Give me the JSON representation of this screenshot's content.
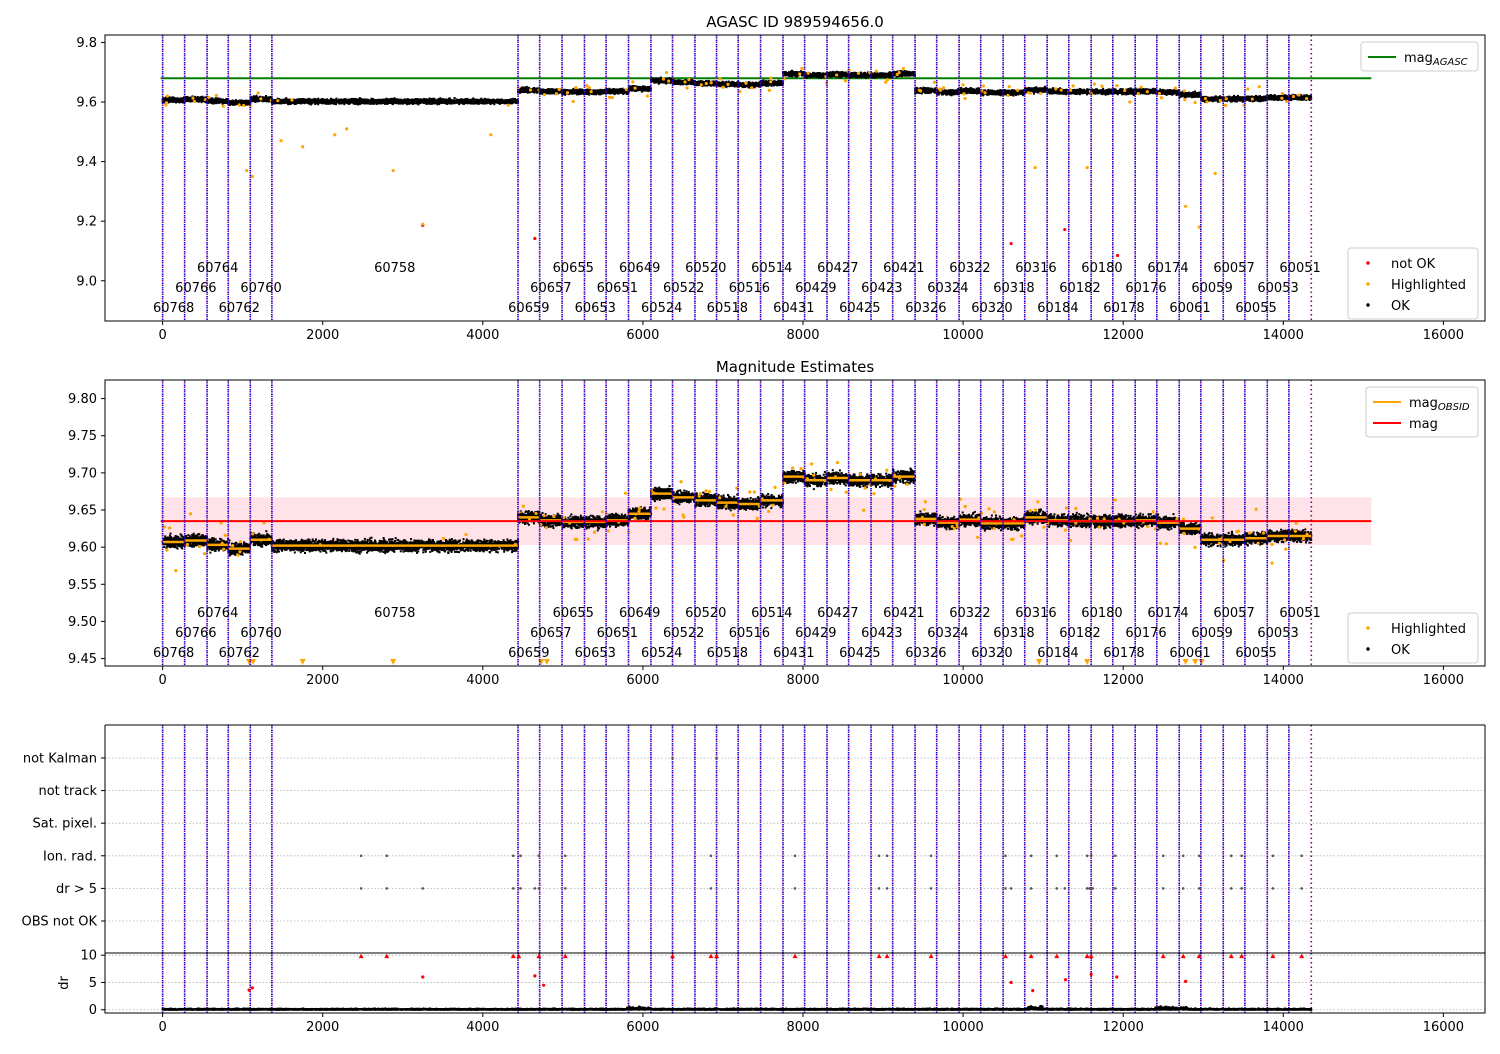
{
  "chart_data": [
    {
      "type": "scatter",
      "title": "AGASC ID 989594656.0",
      "xlim": [
        -720,
        16520
      ],
      "ylim": [
        8.865,
        9.825
      ],
      "xticks": [
        0,
        2000,
        4000,
        6000,
        8000,
        10000,
        12000,
        14000,
        16000
      ],
      "yticks": [
        9.0,
        9.2,
        9.4,
        9.6,
        9.8
      ],
      "ytick_labels": [
        "9.0",
        "9.2",
        "9.4",
        "9.6",
        "9.8"
      ],
      "mag_agasc": 9.68,
      "mag_agasc_color": "#008000",
      "legend_top": [
        {
          "label": "mag",
          "sub": "AGASC",
          "color": "#008000",
          "kind": "line"
        }
      ],
      "legend_bottom": [
        {
          "label": "not OK",
          "color": "#ff0000",
          "kind": "dot"
        },
        {
          "label": "Highlighted",
          "color": "#ffa500",
          "kind": "dot"
        },
        {
          "label": "OK",
          "color": "#000000",
          "kind": "dot"
        }
      ],
      "legend_top_placement": "upper right",
      "legend_bottom_placement": "lower right",
      "grid": false
    },
    {
      "type": "scatter",
      "title": "Magnitude Estimates",
      "xlim": [
        -720,
        16520
      ],
      "ylim": [
        9.44,
        9.825
      ],
      "xticks": [
        0,
        2000,
        4000,
        6000,
        8000,
        10000,
        12000,
        14000,
        16000
      ],
      "yticks": [
        9.45,
        9.5,
        9.55,
        9.6,
        9.65,
        9.7,
        9.75,
        9.8
      ],
      "ytick_labels": [
        "9.45",
        "9.50",
        "9.55",
        "9.60",
        "9.65",
        "9.70",
        "9.75",
        "9.80"
      ],
      "mag": 9.635,
      "mag_band": [
        9.603,
        9.667
      ],
      "mag_color": "#ff0000",
      "mag_obsid_color": "#ffa500",
      "legend_top": [
        {
          "label": "mag",
          "sub": "OBSID",
          "color": "#ffa500",
          "kind": "line"
        },
        {
          "label": "mag",
          "sub": "",
          "color": "#ff0000",
          "kind": "line"
        }
      ],
      "legend_bottom": [
        {
          "label": "Highlighted",
          "color": "#ffa500",
          "kind": "dot"
        },
        {
          "label": "OK",
          "color": "#000000",
          "kind": "dot"
        }
      ],
      "legend_top_placement": "upper right",
      "legend_bottom_placement": "lower right",
      "grid": false
    },
    {
      "type": "scatter",
      "title": "",
      "xlim": [
        -720,
        16520
      ],
      "flag_labels": [
        "not Kalman",
        "not track",
        "Sat. pixel.",
        "Ion. rad.",
        "dr > 5",
        "OBS not OK"
      ],
      "dr_ylabel": "dr",
      "dr_ylim": [
        -0.6,
        10.4
      ],
      "dr_yticks": [
        0,
        5,
        10
      ],
      "dr_ytick_labels": [
        "0",
        "5",
        "10"
      ],
      "xticks": [
        0,
        2000,
        4000,
        6000,
        8000,
        10000,
        12000,
        14000,
        16000
      ],
      "grid_horizontal": true,
      "not_kalman": [
        6370,
        6920
      ],
      "ion_rad": [
        2480,
        2800,
        4380,
        4470,
        4700,
        5030,
        6850,
        7900,
        8950,
        9050,
        9600,
        10530,
        10850,
        11170,
        11550,
        11600,
        11900,
        12500,
        12750,
        12950,
        13350,
        13480,
        13870,
        14230
      ],
      "dr_gt_5": [
        2480,
        2800,
        3250,
        4380,
        4470,
        4650,
        4700,
        5030,
        6850,
        7900,
        8950,
        9050,
        9600,
        10530,
        10600,
        10850,
        11170,
        11270,
        11550,
        11580,
        11620,
        11900,
        12500,
        12750,
        12950,
        13350,
        13480,
        13870,
        14230
      ],
      "dr_capped": [
        2480,
        2800,
        4380,
        4450,
        4700,
        5030,
        6370,
        6850,
        6920,
        7900,
        8950,
        9050,
        9600,
        10530,
        10850,
        11170,
        11550,
        11600,
        12500,
        12750,
        12950,
        13350,
        13480,
        13870,
        14230
      ],
      "dr_points": [
        {
          "x": 1080,
          "y": 3.6
        },
        {
          "x": 1120,
          "y": 4.0
        },
        {
          "x": 3250,
          "y": 6.0
        },
        {
          "x": 4650,
          "y": 6.2
        },
        {
          "x": 4760,
          "y": 4.5
        },
        {
          "x": 10600,
          "y": 5.0
        },
        {
          "x": 10870,
          "y": 3.5
        },
        {
          "x": 11280,
          "y": 5.5
        },
        {
          "x": 11600,
          "y": 6.5
        },
        {
          "x": 11920,
          "y": 6.0
        },
        {
          "x": 12780,
          "y": 5.2
        }
      ]
    }
  ],
  "obsids": [
    {
      "id": "60768",
      "x": 0,
      "row": 2,
      "seg_end": 275
    },
    {
      "id": "60766",
      "x": 275,
      "row": 1,
      "seg_end": 555
    },
    {
      "id": "60764",
      "x": 555,
      "row": 0,
      "seg_end": 820
    },
    {
      "id": "60762",
      "x": 820,
      "row": 2,
      "seg_end": 1095
    },
    {
      "id": "60760",
      "x": 1095,
      "row": 1,
      "seg_end": 1365
    },
    {
      "id": "60758",
      "x": 1365,
      "row": 0,
      "seg_end": 4440
    },
    {
      "id": "60659",
      "x": 4440,
      "row": 2,
      "seg_end": 4710
    },
    {
      "id": "60657",
      "x": 4710,
      "row": 1,
      "seg_end": 4990
    },
    {
      "id": "60655",
      "x": 4990,
      "row": 0,
      "seg_end": 5270
    },
    {
      "id": "60653",
      "x": 5270,
      "row": 2,
      "seg_end": 5540
    },
    {
      "id": "60651",
      "x": 5540,
      "row": 1,
      "seg_end": 5820
    },
    {
      "id": "60649",
      "x": 5820,
      "row": 0,
      "seg_end": 6100
    },
    {
      "id": "60524",
      "x": 6100,
      "row": 2,
      "seg_end": 6370
    },
    {
      "id": "60522",
      "x": 6370,
      "row": 1,
      "seg_end": 6650
    },
    {
      "id": "60520",
      "x": 6650,
      "row": 0,
      "seg_end": 6920
    },
    {
      "id": "60518",
      "x": 6920,
      "row": 2,
      "seg_end": 7190
    },
    {
      "id": "60516",
      "x": 7190,
      "row": 1,
      "seg_end": 7470
    },
    {
      "id": "60514",
      "x": 7470,
      "row": 0,
      "seg_end": 7750
    },
    {
      "id": "60431",
      "x": 7750,
      "row": 2,
      "seg_end": 8020
    },
    {
      "id": "60429",
      "x": 8020,
      "row": 1,
      "seg_end": 8300
    },
    {
      "id": "60427",
      "x": 8300,
      "row": 0,
      "seg_end": 8570
    },
    {
      "id": "60425",
      "x": 8570,
      "row": 2,
      "seg_end": 8850
    },
    {
      "id": "60423",
      "x": 8850,
      "row": 1,
      "seg_end": 9120
    },
    {
      "id": "60421",
      "x": 9120,
      "row": 0,
      "seg_end": 9400
    },
    {
      "id": "60326",
      "x": 9400,
      "row": 2,
      "seg_end": 9670
    },
    {
      "id": "60324",
      "x": 9670,
      "row": 1,
      "seg_end": 9950
    },
    {
      "id": "60322",
      "x": 9950,
      "row": 0,
      "seg_end": 10220
    },
    {
      "id": "60320",
      "x": 10220,
      "row": 2,
      "seg_end": 10500
    },
    {
      "id": "60318",
      "x": 10500,
      "row": 1,
      "seg_end": 10770
    },
    {
      "id": "60316",
      "x": 10770,
      "row": 0,
      "seg_end": 11050
    },
    {
      "id": "60184",
      "x": 11050,
      "row": 2,
      "seg_end": 11320
    },
    {
      "id": "60182",
      "x": 11320,
      "row": 1,
      "seg_end": 11600
    },
    {
      "id": "60180",
      "x": 11600,
      "row": 0,
      "seg_end": 11870
    },
    {
      "id": "60178",
      "x": 11870,
      "row": 2,
      "seg_end": 12150
    },
    {
      "id": "60176",
      "x": 12150,
      "row": 1,
      "seg_end": 12420
    },
    {
      "id": "60174",
      "x": 12420,
      "row": 0,
      "seg_end": 12700
    },
    {
      "id": "60061",
      "x": 12700,
      "row": 2,
      "seg_end": 12970
    },
    {
      "id": "60059",
      "x": 12970,
      "row": 1,
      "seg_end": 13250
    },
    {
      "id": "60057",
      "x": 13250,
      "row": 0,
      "seg_end": 13520
    },
    {
      "id": "60055",
      "x": 13520,
      "row": 2,
      "seg_end": 13800
    },
    {
      "id": "60053",
      "x": 13800,
      "row": 1,
      "seg_end": 14070
    },
    {
      "id": "60051",
      "x": 14070,
      "row": 0,
      "seg_end": 14350
    }
  ],
  "obsid_mags": [
    9.607,
    9.609,
    9.603,
    9.598,
    9.61,
    9.602,
    9.64,
    9.636,
    9.634,
    9.634,
    9.636,
    9.645,
    9.672,
    9.667,
    9.663,
    9.66,
    9.658,
    9.663,
    9.695,
    9.69,
    9.693,
    9.69,
    9.69,
    9.695,
    9.638,
    9.633,
    9.637,
    9.632,
    9.632,
    9.64,
    9.636,
    9.635,
    9.635,
    9.635,
    9.636,
    9.633,
    9.625,
    9.61,
    9.61,
    9.612,
    9.615,
    9.615
  ],
  "colors": {
    "ok": "#000000",
    "highlighted": "#ffa500",
    "not_ok": "#ff0000",
    "obsid_line": "#800080",
    "obsid_line_alt": "#0000ff",
    "band": "#ffc0cb"
  }
}
